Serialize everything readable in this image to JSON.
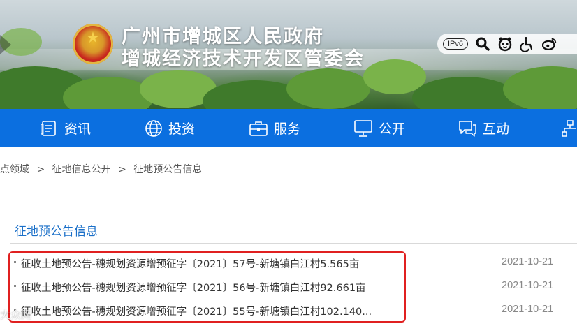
{
  "header": {
    "title_line1": "广州市增城区人民政府",
    "title_line2": "增城经济技术开发区管委会",
    "tools": [
      {
        "label": "IPv6",
        "icon": "ipv6-badge"
      },
      {
        "icon": "search-icon"
      },
      {
        "icon": "elder-mode-icon"
      },
      {
        "icon": "accessibility-icon"
      },
      {
        "icon": "weibo-icon"
      }
    ]
  },
  "nav": {
    "items": [
      {
        "label": "资讯",
        "icon": "news-icon"
      },
      {
        "label": "投资",
        "icon": "globe-icon"
      },
      {
        "label": "服务",
        "icon": "briefcase-icon"
      },
      {
        "label": "公开",
        "icon": "monitor-icon"
      },
      {
        "label": "互动",
        "icon": "chat-icon"
      }
    ]
  },
  "breadcrumb": {
    "items": [
      "点领域",
      "征地信息公开",
      "征地预公告信息"
    ],
    "separator": ">"
  },
  "section": {
    "title": "征地预公告信息"
  },
  "list": {
    "items": [
      {
        "title": "征收土地预公告-穗规划资源增预征字〔2021〕57号-新塘镇白江村5.565亩",
        "date": "2021-10-21"
      },
      {
        "title": "征收土地预公告-穗规划资源增预征字〔2021〕56号-新塘镇白江村92.661亩",
        "date": "2021-10-21"
      },
      {
        "title": "征收土地预公告-穗规划资源增预征字〔2021〕55号-新塘镇白江村102.140...",
        "date": "2021-10-21"
      }
    ]
  },
  "watermark": "大众网",
  "colors": {
    "nav_blue": "#0b6fe0",
    "section_blue": "#1a6fc8",
    "highlight_red": "#e02020"
  }
}
